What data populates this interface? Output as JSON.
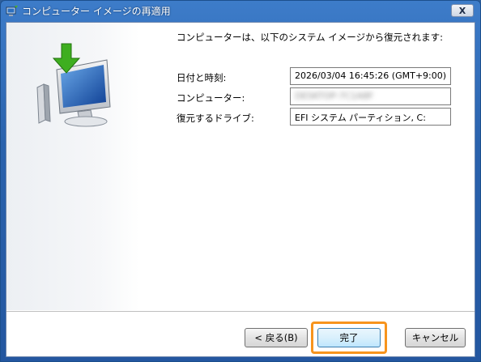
{
  "window": {
    "title": "コンピューター イメージの再適用",
    "close_label": "X"
  },
  "content": {
    "heading": "コンピューターは、以下のシステム イメージから復元されます:",
    "fields": [
      {
        "label": "日付と時刻:",
        "value": "2026/03/04 16:45:26 (GMT+9:00)"
      },
      {
        "label": "コンピューター:",
        "value": "DESKTOP-7C1A8F"
      },
      {
        "label": "復元するドライブ:",
        "value": "EFI システム パーティション, C:"
      }
    ]
  },
  "buttons": {
    "back": "< 戻る(B)",
    "finish": "完了",
    "cancel": "キャンセル"
  },
  "colors": {
    "highlight": "#f7941d",
    "title_bar": "#2a62ad"
  },
  "icons": {
    "title": "system-image-icon",
    "illustration": "restore-computer-icon"
  }
}
